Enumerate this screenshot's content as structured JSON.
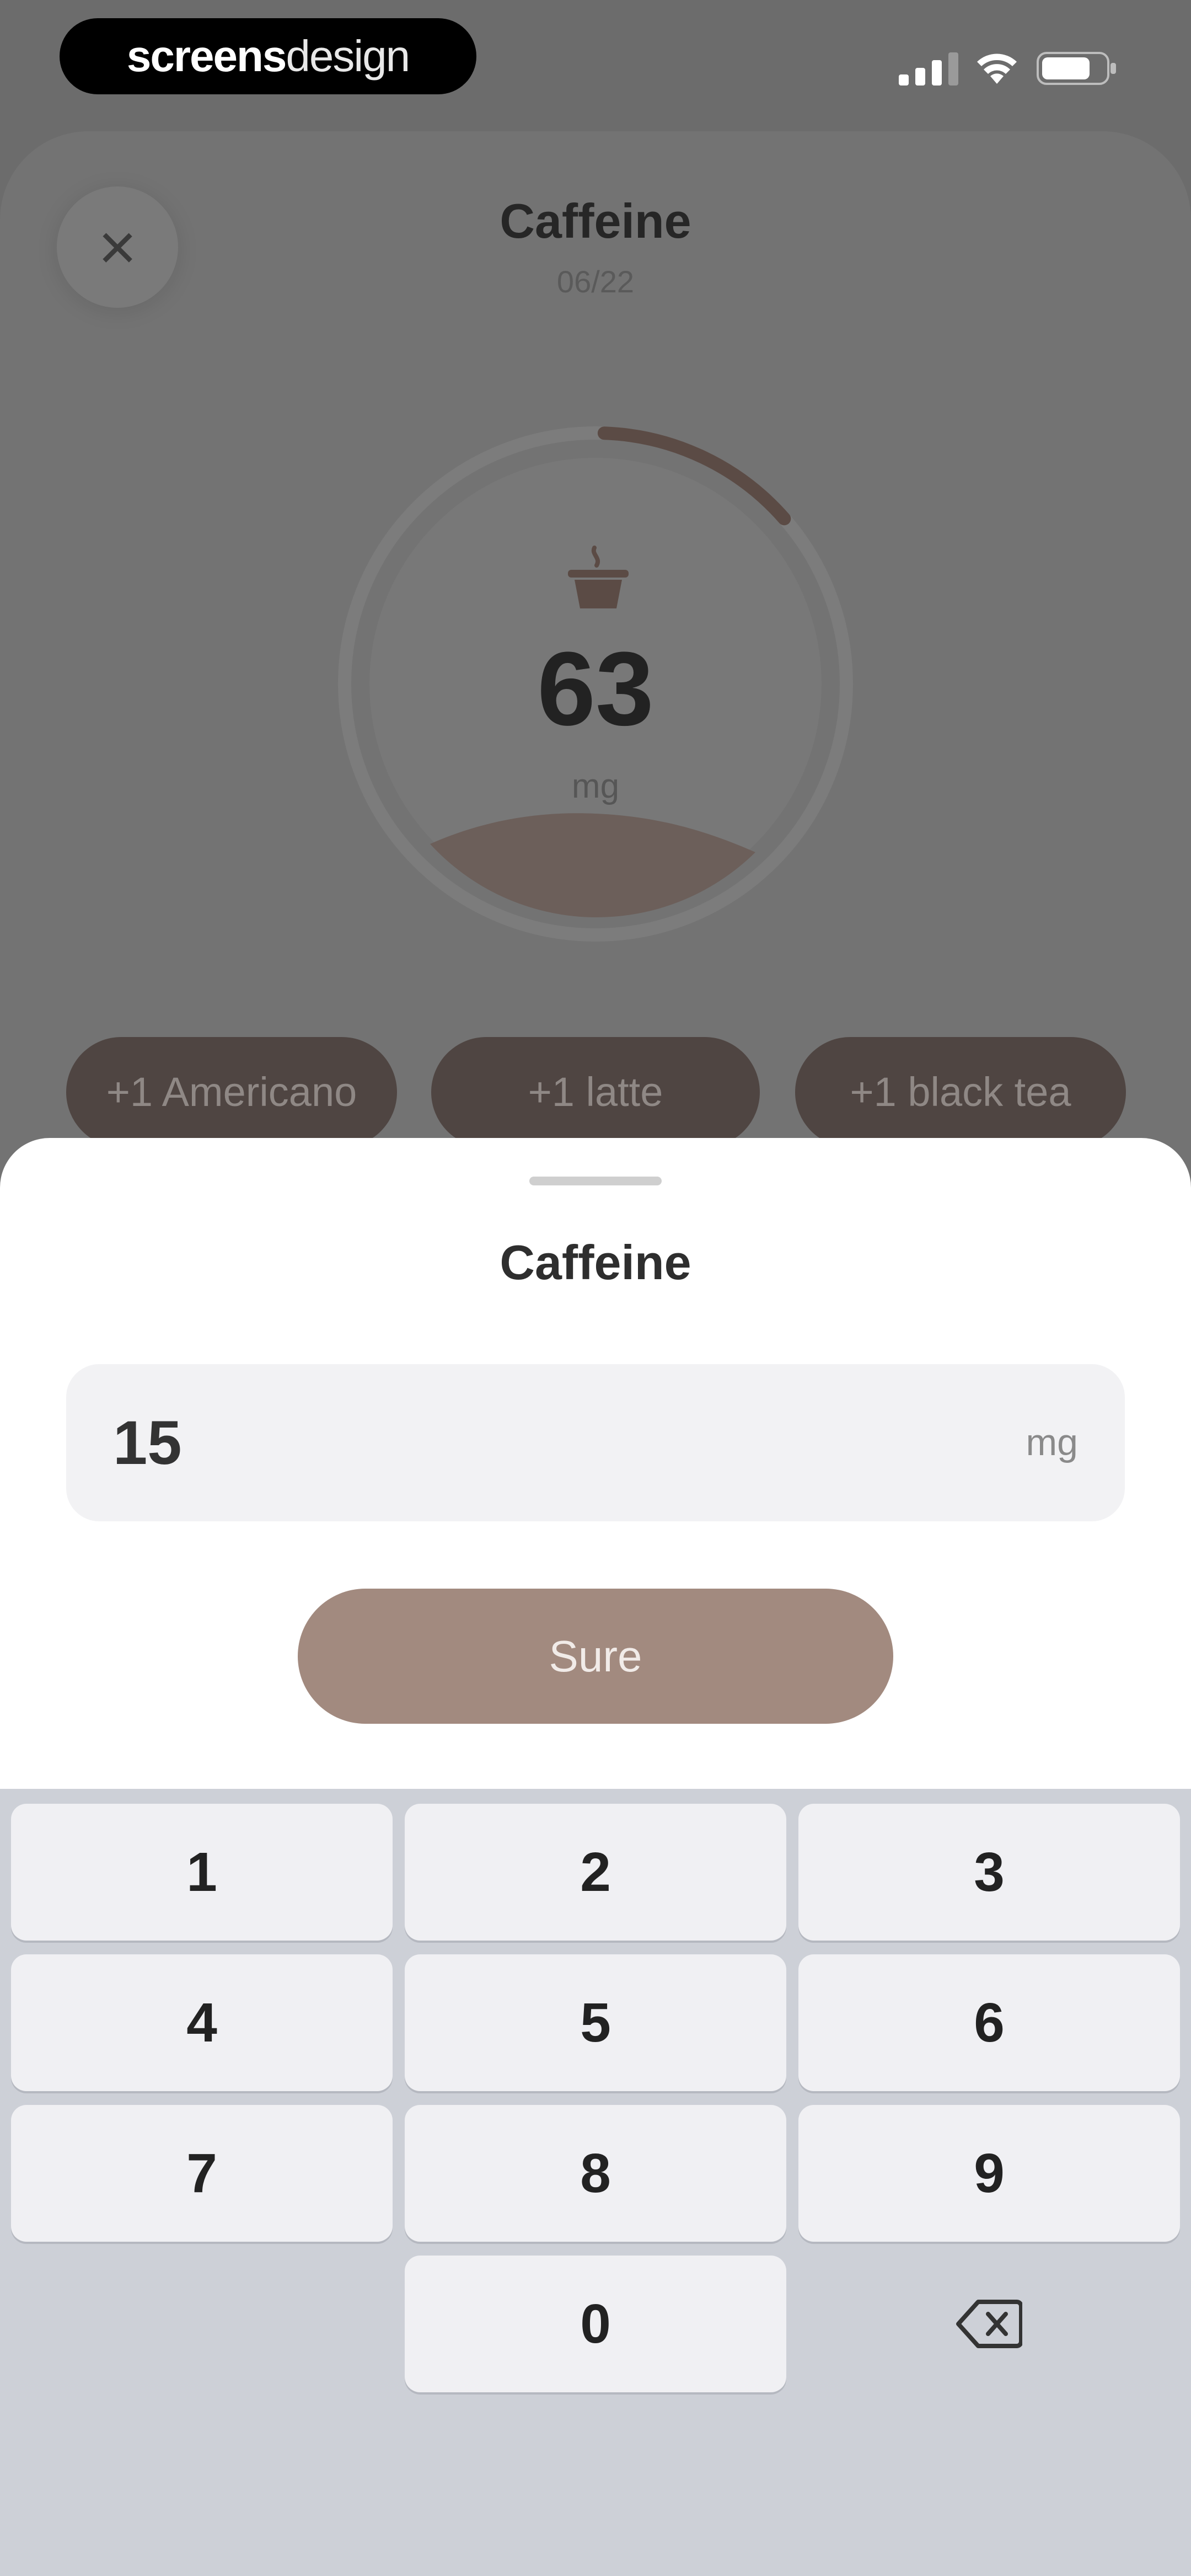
{
  "status_bar": {
    "brand_part1": "screens",
    "brand_part2": "design",
    "icons": [
      "cellular-signal-icon",
      "wifi-icon",
      "battery-icon"
    ]
  },
  "background_screen": {
    "close_icon": "×",
    "title": "Caffeine",
    "date": "06/22",
    "gauge": {
      "icon": "coffee-cup-icon",
      "value": "63",
      "unit": "mg",
      "progress_fraction": 0.13
    },
    "quick_add": [
      {
        "label": "+1 Americano"
      },
      {
        "label": "+1 latte"
      },
      {
        "label": "+1 black tea"
      }
    ]
  },
  "sheet": {
    "title": "Caffeine",
    "amount": {
      "value": "15",
      "unit": "mg"
    },
    "confirm_label": "Sure"
  },
  "keypad": {
    "keys": [
      "1",
      "2",
      "3",
      "4",
      "5",
      "6",
      "7",
      "8",
      "9",
      "0"
    ],
    "backspace_icon": "backspace-icon"
  },
  "colors": {
    "accent_brown": "#a28a7f",
    "dim_overlay_bg": "#737373",
    "keypad_bg": "#cdd0d7",
    "chip_dark": "#4f4542"
  }
}
